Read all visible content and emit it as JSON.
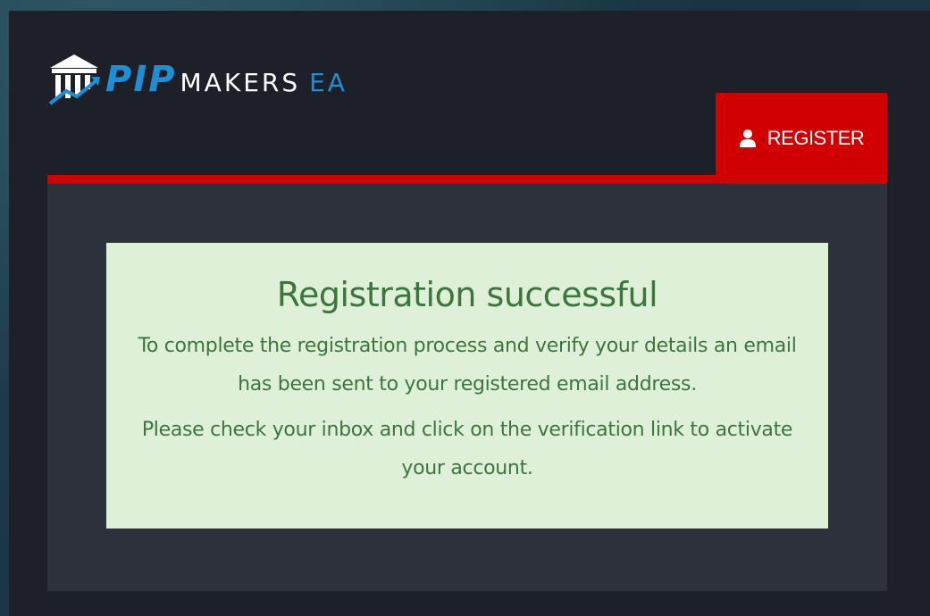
{
  "logo": {
    "pip": "PIP",
    "makers": "MAKERS",
    "ea": "EA",
    "accent_color": "#1e8fd6"
  },
  "header": {
    "register_label": "REGISTER",
    "register_icon": "user-icon",
    "accent_color": "#d00000"
  },
  "alert": {
    "title": "Registration successful",
    "paragraph_1": "To complete the registration process and verify your details an email has been sent to your registered email address.",
    "paragraph_2": "Please check your inbox and click on the verification link to activate your account.",
    "background_color": "#dff0d8",
    "text_color": "#3c763d"
  }
}
